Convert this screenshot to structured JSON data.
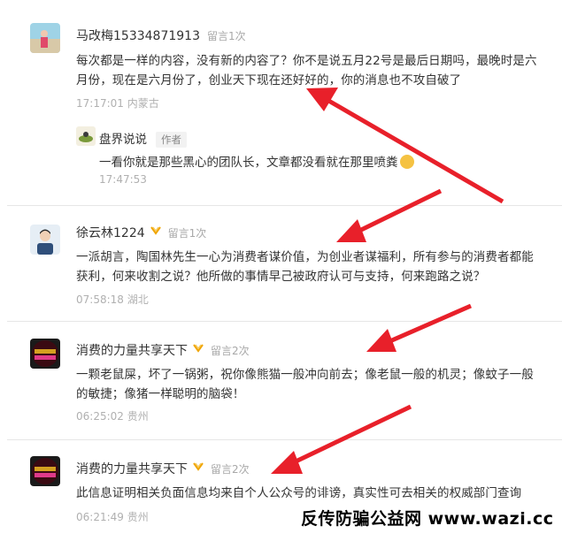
{
  "comments": [
    {
      "name": "马改梅15334871913",
      "badge": "留言1次",
      "text": "每次都是一样的内容，没有新的内容了？你不是说五月22号是最后日期吗，最晚时是六月份，现在是六月份了，创业天下现在还好好的，你的消息也不攻自破了",
      "meta": "17:17:01 内蒙古",
      "reply": {
        "name": "盘界说说",
        "tag": "作者",
        "text": "一看你就是那些黑心的团队长，文章都没看就在那里喷粪",
        "meta": "17:47:53"
      }
    },
    {
      "name": "徐云林1224",
      "badge": "留言1次",
      "text": "一派胡言，陶国林先生一心为消费者谋价值，为创业者谋福利，所有参与的消费者都能获利，何来收割之说？他所做的事情早己被政府认可与支持，何来跑路之说？",
      "meta": "07:58:18 湖北"
    },
    {
      "name": "消费的力量共享天下",
      "badge": "留言2次",
      "text": "一颗老鼠屎，坏了一锅粥，祝你像熊猫一般冲向前去；像老鼠一般的机灵；像蚊子一般的敏捷；像猪一样聪明的脑袋！",
      "meta": "06:25:02 贵州"
    },
    {
      "name": "消费的力量共享天下",
      "badge": "留言2次",
      "text": "此信息证明相关负面信息均来自个人公众号的诽谤，真实性可去相关的权威部门查询",
      "meta": "06:21:49 贵州"
    }
  ],
  "watermark": "反传防骗公益网 www.wazi.cc",
  "colors": {
    "arrow": "#e8202a",
    "medal": "#f0a500",
    "meta": "#b0b0b0"
  }
}
